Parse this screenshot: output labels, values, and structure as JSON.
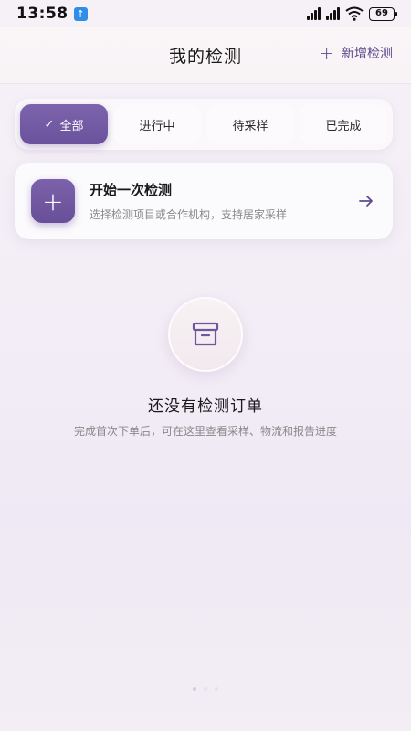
{
  "status_bar": {
    "time": "13:58",
    "upload_badge": "↑",
    "battery": "69"
  },
  "header": {
    "title": "我的检测",
    "add_label": "新增检测",
    "add_icon": "+"
  },
  "tabs": [
    {
      "label": "全部",
      "active": true,
      "icon": "✓"
    },
    {
      "label": "进行中",
      "active": false
    },
    {
      "label": "待采样",
      "active": false
    },
    {
      "label": "已完成",
      "active": false
    }
  ],
  "start_card": {
    "icon": "+",
    "title": "开始一次检测",
    "subtitle": "选择检测项目或合作机构，支持居家采样"
  },
  "empty_state": {
    "icon": "archive-box-icon",
    "title": "还没有检测订单",
    "subtitle": "完成首次下单后，可在这里查看采样、物流和报告进度"
  },
  "colors": {
    "accent": "#6f57a0",
    "background": "#f3eef6"
  }
}
